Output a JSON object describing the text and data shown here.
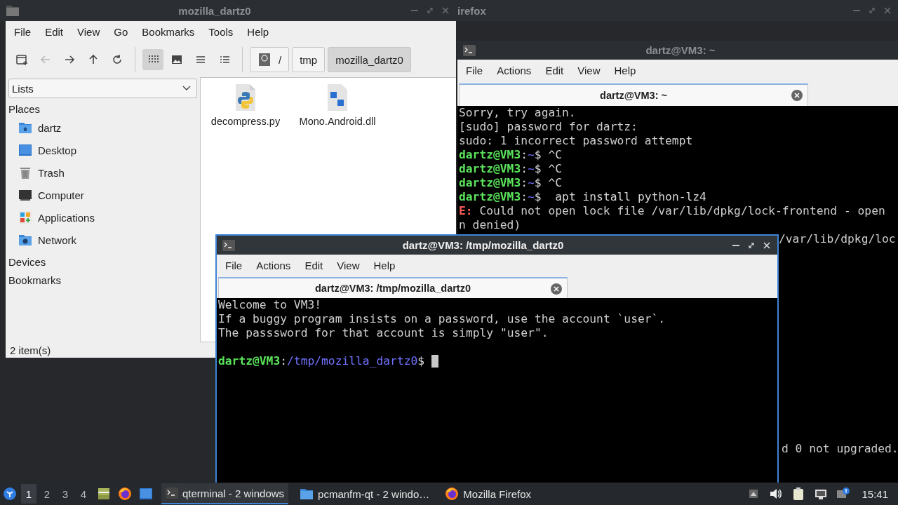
{
  "firefox_window": {
    "title": "irefox",
    "controls": [
      {
        "kind": "minimize"
      },
      {
        "kind": "maximize"
      },
      {
        "kind": "close"
      }
    ]
  },
  "file_manager": {
    "title": "mozilla_dartz0",
    "controls": [
      {
        "kind": "minimize"
      },
      {
        "kind": "maximize"
      },
      {
        "kind": "close"
      }
    ],
    "menu": [
      "File",
      "Edit",
      "View",
      "Go",
      "Bookmarks",
      "Tools",
      "Help"
    ],
    "toolbar": [
      {
        "kind": "new-tab",
        "disabled": false
      },
      {
        "kind": "back",
        "disabled": true
      },
      {
        "kind": "forward",
        "disabled": false
      },
      {
        "kind": "up",
        "disabled": false
      },
      {
        "kind": "reload",
        "disabled": false
      }
    ],
    "views": [
      {
        "kind": "icons",
        "selected": true
      },
      {
        "kind": "thumbnails",
        "selected": false
      },
      {
        "kind": "compact",
        "selected": false
      },
      {
        "kind": "details",
        "selected": false
      }
    ],
    "path": [
      {
        "kind": "root",
        "label": "/",
        "selected": false
      },
      {
        "kind": "dir",
        "label": "tmp",
        "selected": false
      },
      {
        "kind": "dir",
        "label": "mozilla_dartz0",
        "selected": true
      }
    ],
    "side_select": "Lists",
    "places": {
      "heading": "Places",
      "items": [
        {
          "kind": "home",
          "label": "dartz"
        },
        {
          "kind": "desktop",
          "label": "Desktop"
        },
        {
          "kind": "trash",
          "label": "Trash"
        },
        {
          "kind": "computer",
          "label": "Computer"
        },
        {
          "kind": "applications",
          "label": "Applications"
        },
        {
          "kind": "network",
          "label": "Network"
        }
      ]
    },
    "sections": [
      "Devices",
      "Bookmarks"
    ],
    "files": [
      {
        "kind": "python",
        "name": "decompress.py"
      },
      {
        "kind": "library",
        "name": "Mono.Android.dll"
      }
    ],
    "status": "2 item(s)"
  },
  "back_terminal": {
    "title": "dartz@VM3: ~",
    "menu": [
      "File",
      "Actions",
      "Edit",
      "View",
      "Help"
    ],
    "tab": "dartz@VM3: ~",
    "lines": [
      {
        "kind": "text",
        "text": "Sorry, try again."
      },
      {
        "kind": "text",
        "text": "[sudo] password for dartz:"
      },
      {
        "kind": "text",
        "text": "sudo: 1 incorrect password attempt"
      },
      {
        "kind": "prompt",
        "user": "dartz@VM3",
        "colon": ":",
        "path": "~",
        "dollar": "$",
        "command": " ^C"
      },
      {
        "kind": "prompt",
        "user": "dartz@VM3",
        "colon": ":",
        "path": "~",
        "dollar": "$",
        "command": " ^C"
      },
      {
        "kind": "prompt",
        "user": "dartz@VM3",
        "colon": ":",
        "path": "~",
        "dollar": "$",
        "command": " ^C"
      },
      {
        "kind": "prompt",
        "user": "dartz@VM3",
        "colon": ":",
        "path": "~",
        "dollar": "$",
        "command": "  apt install python-lz4"
      },
      {
        "kind": "error",
        "label": "E:",
        "text": " Could not open lock file /var/lib/dpkg/lock-frontend - open"
      },
      {
        "kind": "text",
        "text": "n denied)"
      },
      {
        "kind": "tail",
        "text": "/var/lib/dpkg/loc"
      }
    ],
    "bottom_lines": [
      {
        "kind": "tail",
        "text": "d 0 not upgraded."
      }
    ]
  },
  "front_terminal": {
    "title": "dartz@VM3: /tmp/mozilla_dartz0",
    "controls": [
      {
        "kind": "minimize"
      },
      {
        "kind": "maximize"
      },
      {
        "kind": "close"
      }
    ],
    "menu": [
      "File",
      "Actions",
      "Edit",
      "View",
      "Help"
    ],
    "tab": "dartz@VM3: /tmp/mozilla_dartz0",
    "lines": [
      {
        "kind": "text",
        "text": "Welcome to VM3!"
      },
      {
        "kind": "text",
        "text": "If a buggy program insists on a password, use the account `user`."
      },
      {
        "kind": "text",
        "text": "The passsword for that account is simply \"user\"."
      }
    ],
    "prompt": {
      "user": "dartz@VM3",
      "colon": ":",
      "path": "/tmp/mozilla_dartz0",
      "dollar": "$",
      "cursor": true
    }
  },
  "taskbar": {
    "workspaces": [
      {
        "label": "1",
        "selected": true
      },
      {
        "label": "2",
        "selected": false
      },
      {
        "label": "3",
        "selected": false
      },
      {
        "label": "4",
        "selected": false
      }
    ],
    "launchers": [
      {
        "kind": "files"
      },
      {
        "kind": "firefox"
      },
      {
        "kind": "desktop"
      }
    ],
    "tasks": [
      {
        "kind": "terminal",
        "label": "qterminal - 2 windows",
        "selected": true
      },
      {
        "kind": "folder",
        "label": "pcmanfm-qt - 2 windo…",
        "selected": false
      },
      {
        "kind": "firefox",
        "label": "Mozilla Firefox",
        "selected": false
      }
    ],
    "tray": [
      {
        "kind": "expand"
      },
      {
        "kind": "volume"
      },
      {
        "kind": "clipboard"
      },
      {
        "kind": "network"
      },
      {
        "kind": "notification"
      }
    ],
    "clock": "15:41"
  }
}
